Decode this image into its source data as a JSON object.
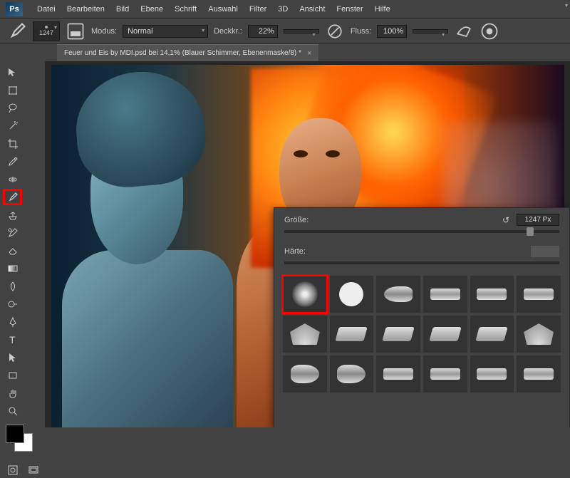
{
  "app": {
    "logo": "Ps"
  },
  "menu": [
    "Datei",
    "Bearbeiten",
    "Bild",
    "Ebene",
    "Schrift",
    "Auswahl",
    "Filter",
    "3D",
    "Ansicht",
    "Fenster",
    "Hilfe"
  ],
  "options": {
    "brush_size": "1247",
    "mode_label": "Modus:",
    "mode_value": "Normal",
    "opacity_label": "Deckkr.:",
    "opacity_value": "22%",
    "flow_label": "Fluss:",
    "flow_value": "100%"
  },
  "doc_tab": "Feuer und Eis by MDI.psd bei 14,1% (Blauer Schimmer, Ebenenmaske/8) *",
  "brush_panel": {
    "size_label": "Größe:",
    "size_value": "1247 Px",
    "hardness_label": "Härte:"
  }
}
